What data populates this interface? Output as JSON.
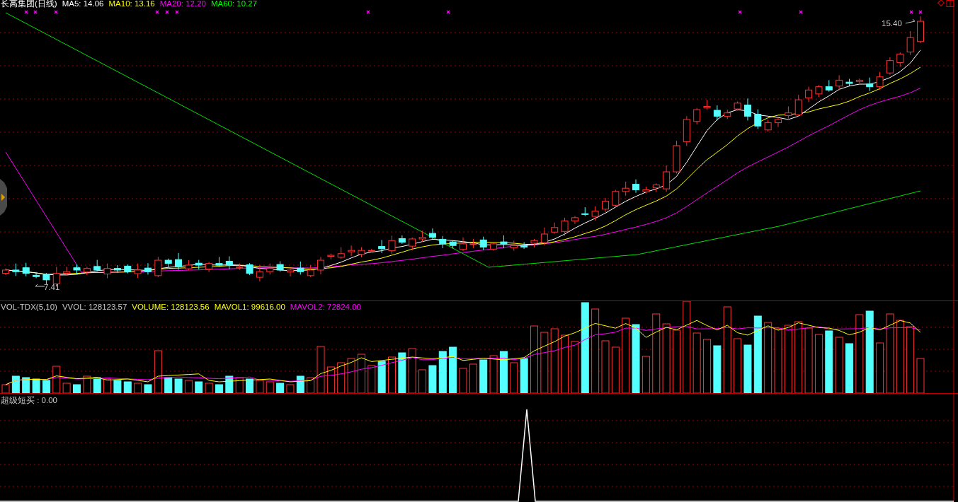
{
  "main_panel": {
    "title": "长高集团(日线)",
    "indicators": [
      {
        "label": "MA5: 14.06",
        "color": "#ffffff"
      },
      {
        "label": "MA10: 13.16",
        "color": "#ffff00"
      },
      {
        "label": "MA20: 12.20",
        "color": "#ff00ff"
      },
      {
        "label": "MA60: 10.27",
        "color": "#00ff00"
      }
    ],
    "high_label": "15.40",
    "low_label": "7.41"
  },
  "volume_panel": {
    "indicators": [
      {
        "label": "VOL-TDX(5,10)",
        "color": "#c8c8c8"
      },
      {
        "label": "VVOL: 128123.57",
        "color": "#c8c8c8"
      },
      {
        "label": "VOLUME: 128123.56",
        "color": "#ffff00"
      },
      {
        "label": "MAVOL1: 99616.00",
        "color": "#ffff00"
      },
      {
        "label": "MAVOL2: 72824.00",
        "color": "#ff00ff"
      }
    ]
  },
  "signal_panel": {
    "label": "超级短买 : 0.00"
  }
}
